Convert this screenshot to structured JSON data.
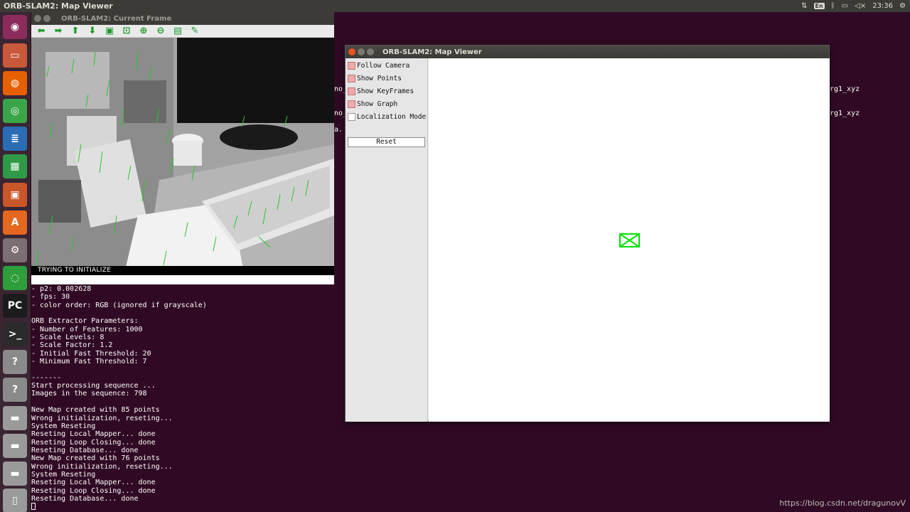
{
  "topbar": {
    "title": "ORB-SLAM2: Map Viewer",
    "keyboard_layout": "En",
    "clock": "23:36"
  },
  "launcher": {
    "items": [
      {
        "name": "ubuntu-dash-icon",
        "glyph": "◉",
        "color": "#8c2c5c"
      },
      {
        "name": "files-icon",
        "glyph": "▭",
        "color": "#c8593a"
      },
      {
        "name": "firefox-icon",
        "glyph": "◍",
        "color": "#e66000"
      },
      {
        "name": "chrome-icon",
        "glyph": "◎",
        "color": "#3aa548"
      },
      {
        "name": "writer-icon",
        "glyph": "≣",
        "color": "#2a6db5"
      },
      {
        "name": "calc-icon",
        "glyph": "▦",
        "color": "#2f9a45"
      },
      {
        "name": "impress-icon",
        "glyph": "▣",
        "color": "#c9562a"
      },
      {
        "name": "software-center-icon",
        "glyph": "A",
        "color": "#e4681f"
      },
      {
        "name": "settings-icon",
        "glyph": "⚙",
        "color": "#7c6f73"
      },
      {
        "name": "update-icon",
        "glyph": "◌",
        "color": "#2e9e3a"
      },
      {
        "name": "pycharm-icon",
        "glyph": "PC",
        "color": "#1c1c1c"
      },
      {
        "name": "terminal-icon",
        "glyph": ">_",
        "color": "#2b2b2b"
      },
      {
        "name": "unknown-app-icon",
        "glyph": "?",
        "color": "#8a8a8a"
      },
      {
        "name": "unknown-app-icon",
        "glyph": "?",
        "color": "#8a8a8a"
      },
      {
        "name": "drive-icon",
        "glyph": "▬",
        "color": "#9a9a9a"
      },
      {
        "name": "drive-icon",
        "glyph": "▬",
        "color": "#9a9a9a"
      },
      {
        "name": "drive-icon",
        "glyph": "▬",
        "color": "#9a9a9a"
      },
      {
        "name": "trash-icon",
        "glyph": "▯",
        "color": "#9a9a9a"
      }
    ]
  },
  "current_frame": {
    "title": "ORB-SLAM2: Current Frame",
    "status": "TRYING TO INITIALIZE",
    "toolbar": [
      {
        "name": "back-arrow-icon",
        "glyph": "⬅"
      },
      {
        "name": "forward-arrow-icon",
        "glyph": "➡"
      },
      {
        "name": "up-arrow-icon",
        "glyph": "⬆"
      },
      {
        "name": "down-arrow-icon",
        "glyph": "⬇"
      },
      {
        "name": "image-icon",
        "glyph": "▣"
      },
      {
        "name": "zoom-fit-icon",
        "glyph": "⊡"
      },
      {
        "name": "zoom-in-icon",
        "glyph": "⊕"
      },
      {
        "name": "zoom-out-icon",
        "glyph": "⊖"
      },
      {
        "name": "save-icon",
        "glyph": "▤"
      },
      {
        "name": "brush-icon",
        "glyph": "✎"
      }
    ]
  },
  "terminal": {
    "lines": [
      "- p2: 0.002628",
      "- fps: 30",
      "- color order: RGB (ignored if grayscale)",
      "",
      "ORB Extractor Parameters:",
      "- Number of Features: 1000",
      "- Scale Levels: 8",
      "- Scale Factor: 1.2",
      "- Initial Fast Threshold: 20",
      "- Minimum Fast Threshold: 7",
      "",
      "-------",
      "Start processing sequence ...",
      "Images in the sequence: 798",
      "",
      "New Map created with 85 points",
      "Wrong initialization, reseting...",
      "System Reseting",
      "Reseting Local Mapper... done",
      "Reseting Loop Closing... done",
      "Reseting Database... done",
      "New Map created with 76 points",
      "Wrong initialization, reseting...",
      "System Reseting",
      "Reseting Local Mapper... done",
      "Reseting Loop Closing... done",
      "Reseting Database... done"
    ],
    "fragments": [
      "no_",
      "no_",
      "a.",
      "rg1_xyz",
      "rg1_xyz"
    ]
  },
  "map_viewer": {
    "title": "ORB-SLAM2: Map Viewer",
    "options": [
      {
        "label": "Follow Camera",
        "checked": true
      },
      {
        "label": "Show Points",
        "checked": true
      },
      {
        "label": "Show KeyFrames",
        "checked": true
      },
      {
        "label": "Show Graph",
        "checked": true
      },
      {
        "label": "Localization Mode",
        "checked": false
      }
    ],
    "reset_label": "Reset",
    "camera_color": "#00e000"
  },
  "watermark": "https://blog.csdn.net/dragunovV"
}
